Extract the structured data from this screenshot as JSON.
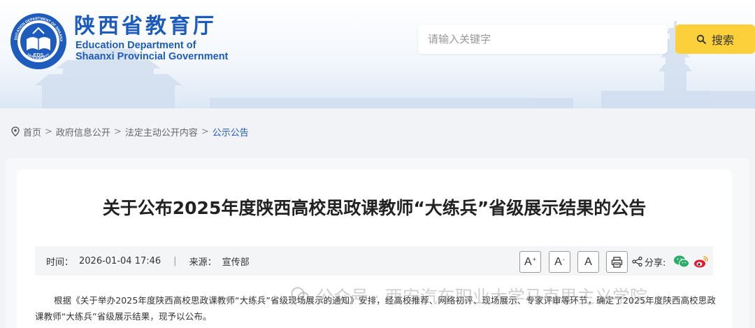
{
  "header": {
    "org_name_cn": "陕西省教育厅",
    "org_name_en_line1": "Education Department of",
    "org_name_en_line2": "Shaanxi Provincial Government",
    "emblem_icon": "eds-emblem-icon",
    "emblem_text_top": "EDUCATION DEPARTMENT OF SHAANXI",
    "emblem_text_center": "EDS",
    "emblem_text_bottom": "陕西省教育厅",
    "brand_color": "#1d5bbd"
  },
  "search": {
    "placeholder": "请输入关键字",
    "button_label": "搜索",
    "button_icon": "search-icon",
    "button_color": "#fcd03a"
  },
  "breadcrumb": {
    "icon": "location-pin-icon",
    "items": [
      "首页",
      "政府信息公开",
      "法定主动公开内容",
      "公示公告"
    ],
    "separator": ">"
  },
  "article": {
    "title": "关于公布2025年度陕西高校思政课教师“大练兵”省级展示结果的公告",
    "meta": {
      "time_label": "时间：",
      "time_value": "2026-01-04 17:46",
      "divider": "|",
      "source_label": "来源：",
      "source_value": "宣传部"
    },
    "tools": {
      "font_increase": "A",
      "font_increase_sup": "+",
      "font_decrease": "A",
      "font_decrease_sup": "-",
      "font_reset": "A",
      "print_icon": "printer-icon",
      "share_icon": "share-icon",
      "share_label": "分享:",
      "wechat_icon": "wechat-icon",
      "weibo_icon": "weibo-icon"
    },
    "body": "根据《关于举办2025年度陕西高校思政课教师“大练兵”省级现场展示的通知》安排，经高校推荐、网络初评、现场展示、专家评审等环节，确定了2025年度陕西高校思政课教师“大练兵”省级展示结果，现予以公布。"
  },
  "watermark": {
    "icon": "wechat-official-account-icon",
    "text": "公众号 · 西安汽车职业大学马克思主义学院"
  }
}
